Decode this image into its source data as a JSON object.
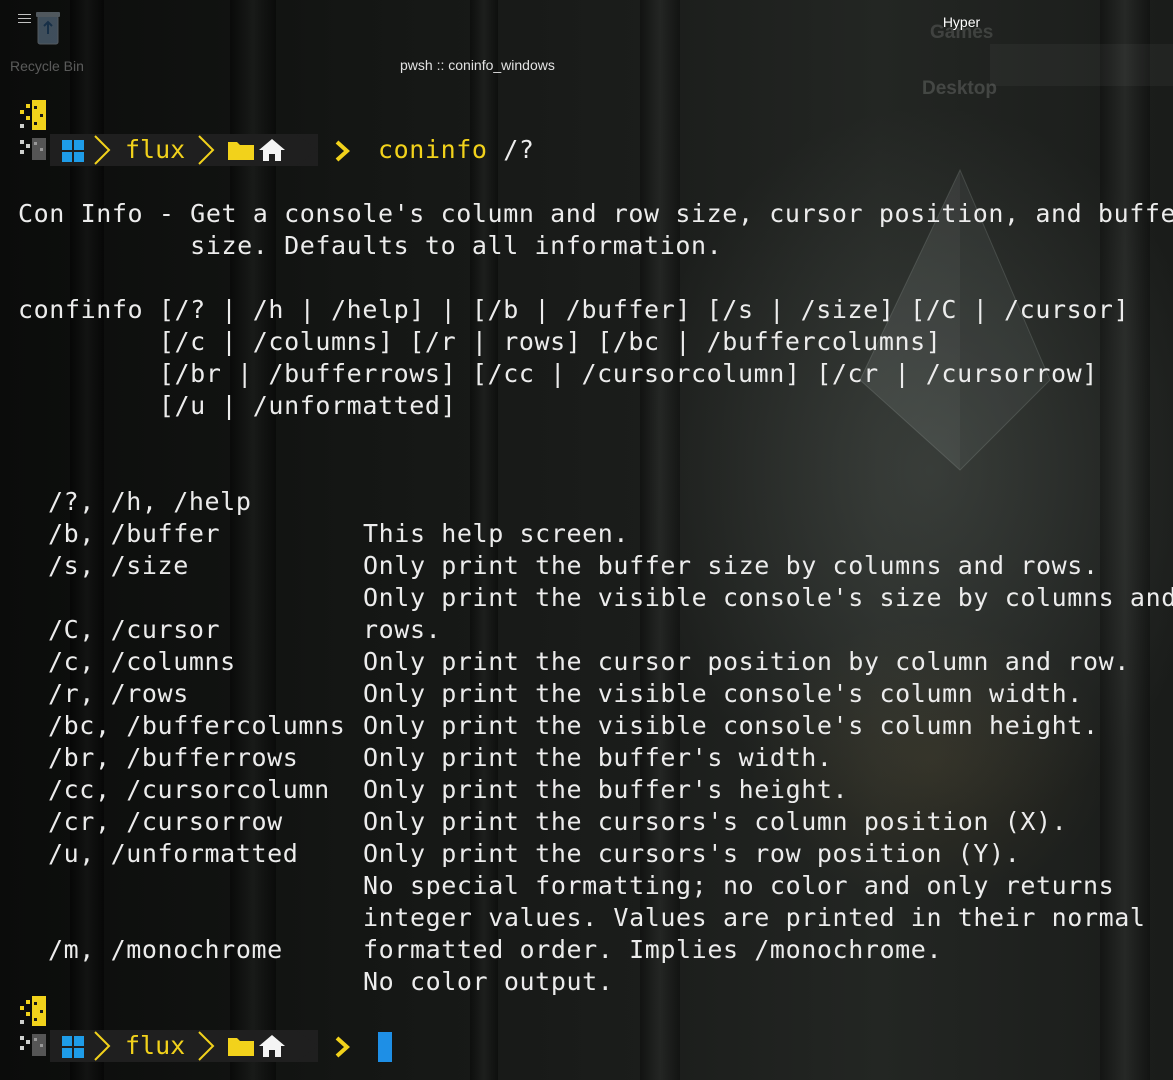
{
  "desktop": {
    "recycle_bin_label": "Recycle Bin",
    "games_label": "Games",
    "desktop_label": "Desktop"
  },
  "window": {
    "app_title": "Hyper",
    "tab_title": "pwsh :: coninfo_windows"
  },
  "prompt": {
    "directory": "flux",
    "os_icon": "windows-logo-icon",
    "folder_icon": "folder-icon",
    "home_icon": "home-icon",
    "arrow": "❯",
    "colors": {
      "accent": "#f2d21b",
      "windows_blue": "#1e9ce8",
      "cursor": "#1e8fe6"
    }
  },
  "command": {
    "name": "coninfo",
    "args": " /?"
  },
  "output": {
    "description": [
      "Con Info - Get a console's column and row size, cursor position, and buffer",
      "           size. Defaults to all information."
    ],
    "usage": [
      "confinfo [/? | /h | /help] | [/b | /buffer] [/s | /size] [/C | /cursor]",
      "         [/c | /columns] [/r | rows] [/bc | /buffercolumns]",
      "         [/br | /bufferrows] [/cc | /cursorcolumn] [/cr | /cursorrow]",
      "         [/u | /unformatted]"
    ],
    "options": [
      {
        "opt": "/?, /h, /help",
        "desc": "This help screen."
      },
      {
        "opt": "/b, /buffer",
        "desc": "Only print the buffer size by columns and rows."
      },
      {
        "opt": "/s, /size",
        "desc": "Only print the visible console's size by columns and"
      },
      {
        "opt": "",
        "desc": "rows."
      },
      {
        "opt": "/C, /cursor",
        "desc": "Only print the cursor position by column and row."
      },
      {
        "opt": "/c, /columns",
        "desc": "Only print the visible console's column width."
      },
      {
        "opt": "/r, /rows",
        "desc": "Only print the visible console's column height."
      },
      {
        "opt": "/bc, /buffercolumns",
        "desc": "Only print the buffer's width."
      },
      {
        "opt": "/br, /bufferrows",
        "desc": "Only print the buffer's height."
      },
      {
        "opt": "/cc, /cursorcolumn",
        "desc": "Only print the cursors's column position (X)."
      },
      {
        "opt": "/cr, /cursorrow",
        "desc": "Only print the cursors's row position (Y)."
      },
      {
        "opt": "/u, /unformatted",
        "desc": "No special formatting; no color and only returns"
      },
      {
        "opt": "",
        "desc": "integer values. Values are printed in their normal"
      },
      {
        "opt": "",
        "desc": "formatted order. Implies /monochrome."
      },
      {
        "opt": "/m, /monochrome",
        "desc": "No color output."
      }
    ]
  }
}
